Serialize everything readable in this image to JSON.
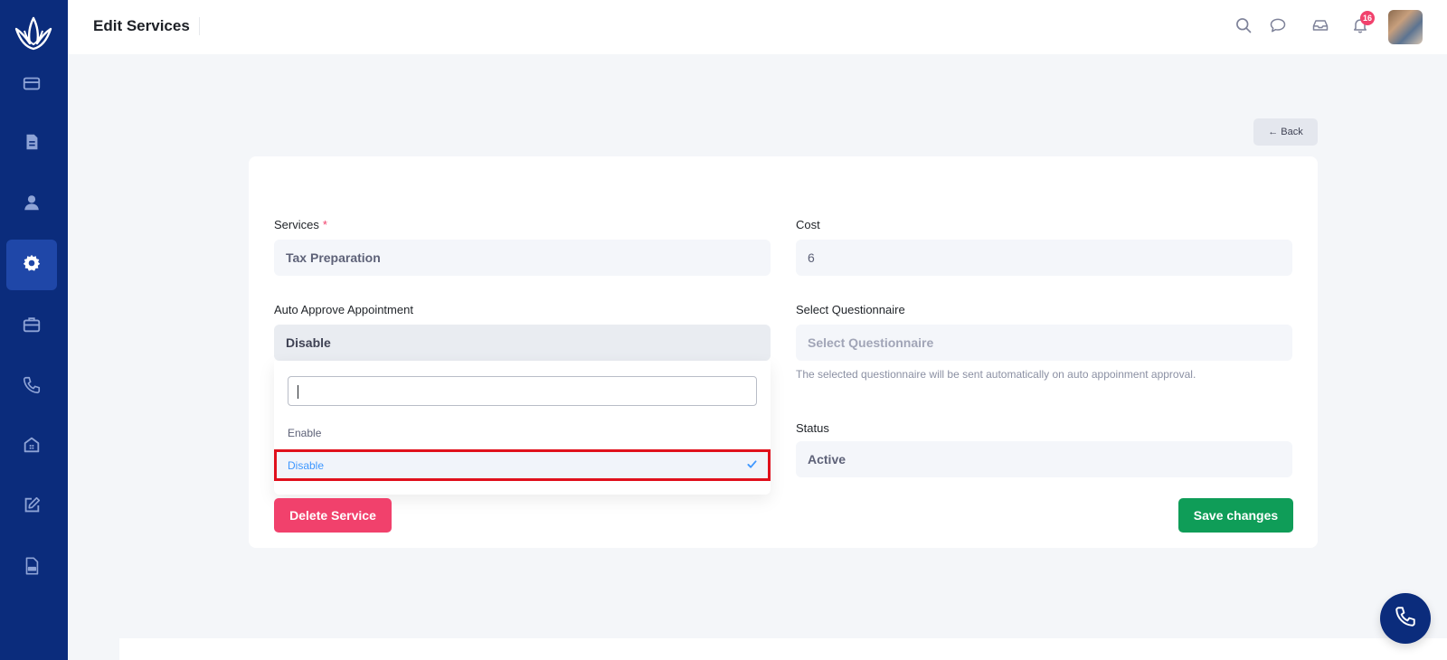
{
  "header": {
    "title": "Edit Services",
    "notification_count": "16"
  },
  "sidebar": {
    "items": [
      {
        "name": "wallet-icon"
      },
      {
        "name": "document-icon"
      },
      {
        "name": "user-icon"
      },
      {
        "name": "gear-icon",
        "active": true
      },
      {
        "name": "briefcase-icon"
      },
      {
        "name": "phone-icon"
      },
      {
        "name": "building-icon"
      },
      {
        "name": "edit-icon"
      },
      {
        "name": "pdf-icon"
      }
    ]
  },
  "toolbar": {
    "back_label": "← Back"
  },
  "form": {
    "services": {
      "label": "Services",
      "required_mark": "*",
      "value": "Tax Preparation"
    },
    "cost": {
      "label": "Cost",
      "value": "6"
    },
    "auto_approve": {
      "label": "Auto Approve Appointment",
      "value": "Disable"
    },
    "questionnaire": {
      "label": "Select Questionnaire",
      "placeholder": "Select Questionnaire",
      "hint": "The selected questionnaire will be sent automatically on auto appoinment approval."
    },
    "status": {
      "label": "Status",
      "value": "Active"
    }
  },
  "dropdown": {
    "options": [
      {
        "label": "Enable",
        "selected": false
      },
      {
        "label": "Disable",
        "selected": true
      }
    ]
  },
  "actions": {
    "delete_label": "Delete Service",
    "save_label": "Save changes"
  },
  "colors": {
    "sidebar": "#0b2c7c",
    "danger": "#f1416c",
    "success": "#0f9d58",
    "selected_text": "#3e97ff",
    "highlight": "#e0101c"
  }
}
